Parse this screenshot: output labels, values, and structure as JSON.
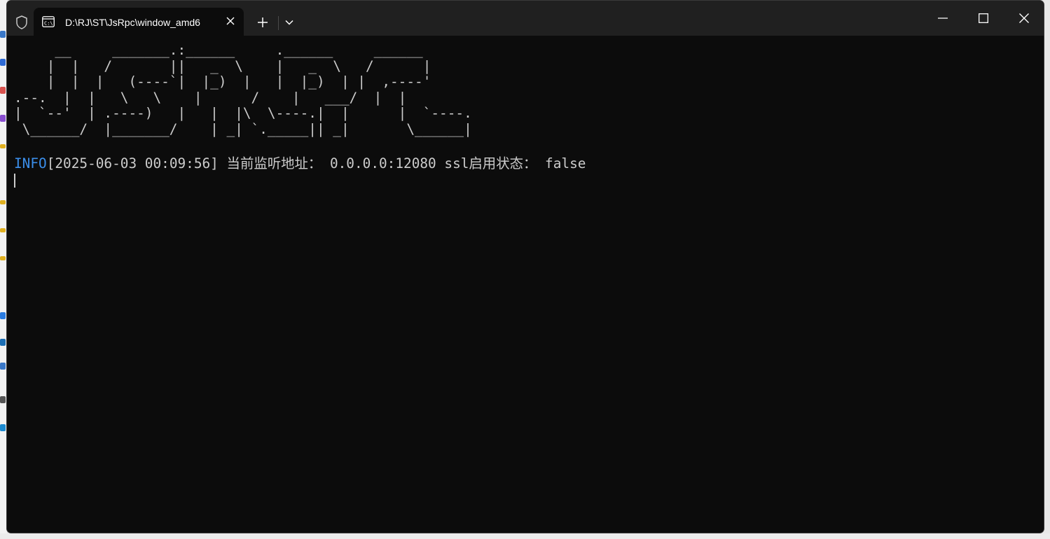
{
  "window": {
    "tab_title": "D:\\RJ\\ST\\JsRpc\\window_amd6",
    "icons": {
      "shield": "shield-icon",
      "terminal": "terminal-icon",
      "close_tab": "close-icon",
      "new_tab": "plus-icon",
      "dropdown": "chevron-down-icon",
      "minimize": "minimize-icon",
      "maximize": "maximize-icon",
      "close_window": "close-icon"
    }
  },
  "terminal": {
    "ascii_banner": "     __     _______.:______     .______     ______\n    |  |   /       ||   _  \\    |   _  \\   /      |\n    |  |  |   (----`|  |_)  |   |  |_)  | |  ,----'\n.--.  |  |   \\   \\    |      /    |   ___/  |  |\n|  `--'  | .----)   |   |  |\\  \\----.|  |      |  `----.\n \\______/  |_______/    | _| `._____|| _|       \\______|",
    "log": {
      "level": "INFO",
      "timestamp": "[2025-06-03 00:09:56]",
      "message": " 当前监听地址： 0.0.0.0:12080 ssl启用状态： false"
    }
  },
  "colors": {
    "terminal_bg": "#0c0c0c",
    "text": "#cccccc",
    "info_level": "#3b8eea",
    "titlebar_bg": "#202020"
  }
}
